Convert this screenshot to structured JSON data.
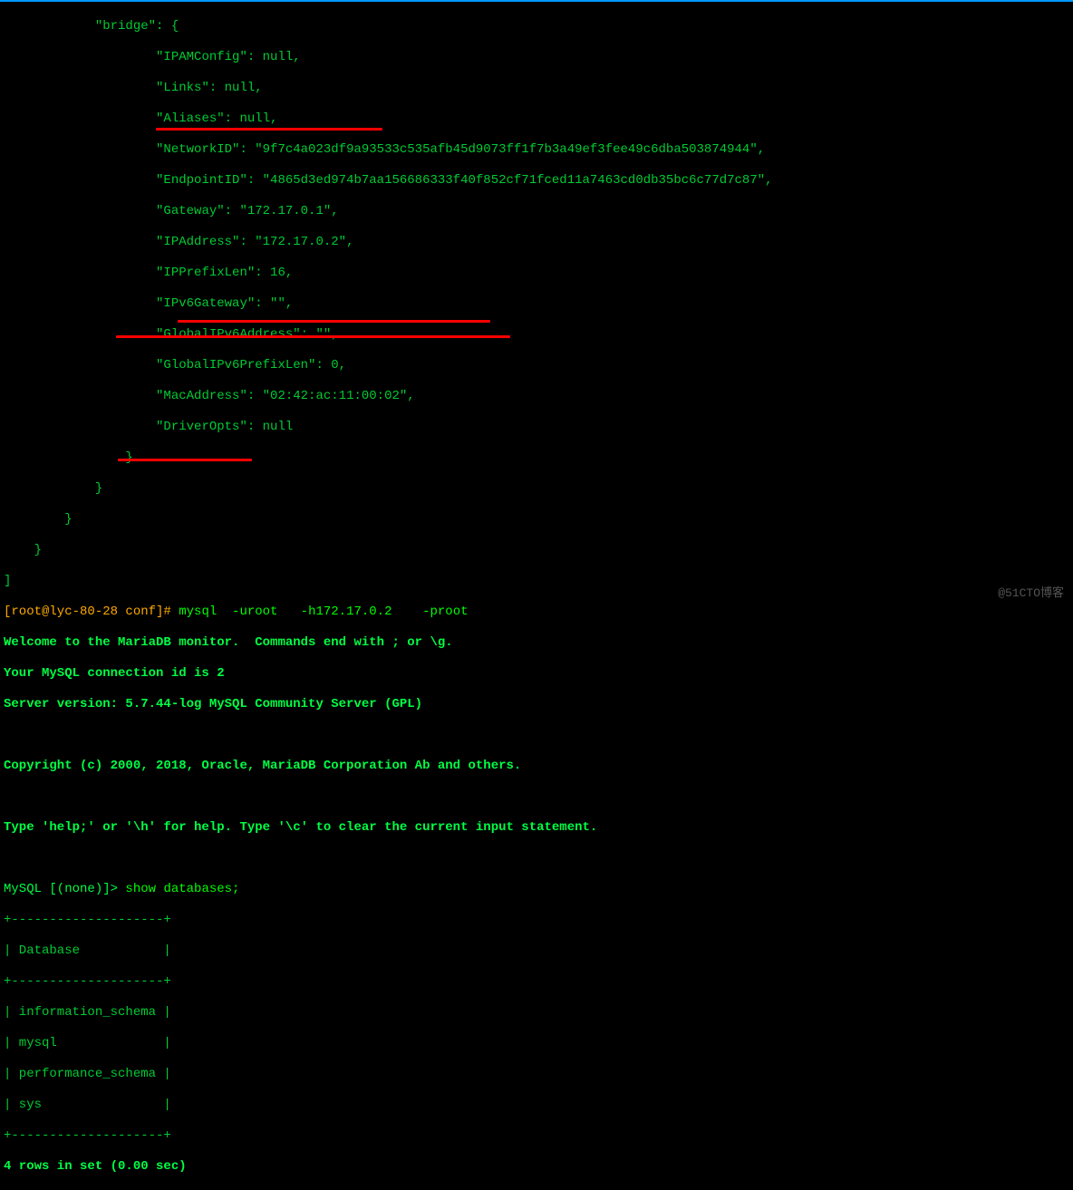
{
  "json": {
    "indent3": "            ",
    "indent4": "                ",
    "indent5": "                    ",
    "bridge_key": "\"bridge\": {",
    "ipam": "\"IPAMConfig\": null,",
    "links": "\"Links\": null,",
    "aliases": "\"Aliases\": null,",
    "networkid": "\"NetworkID\": \"9f7c4a023df9a93533c535afb45d9073ff1f7b3a49ef3fee49c6dba503874944\",",
    "endpointid": "\"EndpointID\": \"4865d3ed974b7aa156686333f40f852cf71fced11a7463cd0db35bc6c77d7c87\",",
    "gateway": "\"Gateway\": \"172.17.0.1\",",
    "ipaddress": "\"IPAddress\": \"172.17.0.2\",",
    "ipprefixlen": "\"IPPrefixLen\": 16,",
    "ipv6gateway": "\"IPv6Gateway\": \"\",",
    "globalipv6address": "\"GlobalIPv6Address\": \"\",",
    "globalipv6prefixlen": "\"GlobalIPv6PrefixLen\": 0,",
    "macaddress": "\"MacAddress\": \"02:42:ac:11:00:02\",",
    "driveropts": "\"DriverOpts\": null",
    "close_braces4": "                }",
    "close_braces3": "            }",
    "close_braces2": "        }",
    "close_braces1": "    }",
    "close_bracket": "]"
  },
  "prompt": "[root@lyc-80-28 conf]#",
  "command": " mysql  -uroot   -h172.17.0.2    -proot",
  "welcome1": "Welcome to the MariaDB monitor.  Commands end with ; or \\g.",
  "welcome2": "Your MySQL connection id is 2",
  "welcome3": "Server version: 5.7.44-log MySQL Community Server (GPL)",
  "copyright": "Copyright (c) 2000, 2018, Oracle, MariaDB Corporation Ab and others.",
  "help": "Type 'help;' or '\\h' for help. Type '\\c' to clear the current input statement.",
  "mysql_prompt": "MySQL [(none)]>",
  "mysql_cmd": " show databases;",
  "table_border": "+--------------------+",
  "table_head": "| Database           |",
  "table_row1": "| information_schema |",
  "table_row2": "| mysql              |",
  "table_row3": "| performance_schema |",
  "table_row4": "| sys                |",
  "result": "4 rows in set (0.00 sec)",
  "watermark": "@51CTO博客"
}
